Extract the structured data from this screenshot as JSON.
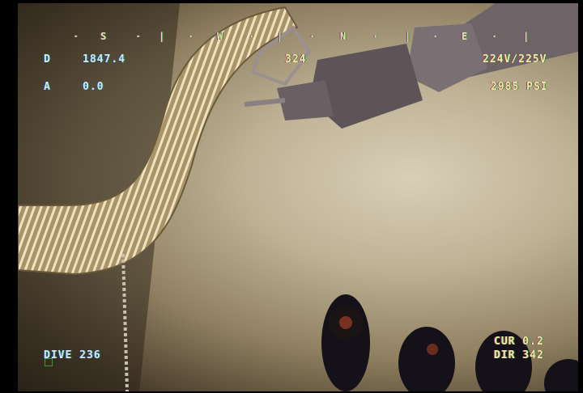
{
  "compass": {
    "marks": [
      "S",
      "W",
      "N",
      "E"
    ],
    "ticks": [
      "·",
      "|"
    ]
  },
  "telemetry": {
    "depth_label": "D",
    "depth_value": "1847.4",
    "altitude_label": "A",
    "altitude_value": "0.0",
    "heading": "324",
    "voltage": "224V/225V",
    "pressure": "2985 PSI",
    "dive": "DIVE 236",
    "current": "CUR 0.2",
    "direction": "DIR 342"
  }
}
